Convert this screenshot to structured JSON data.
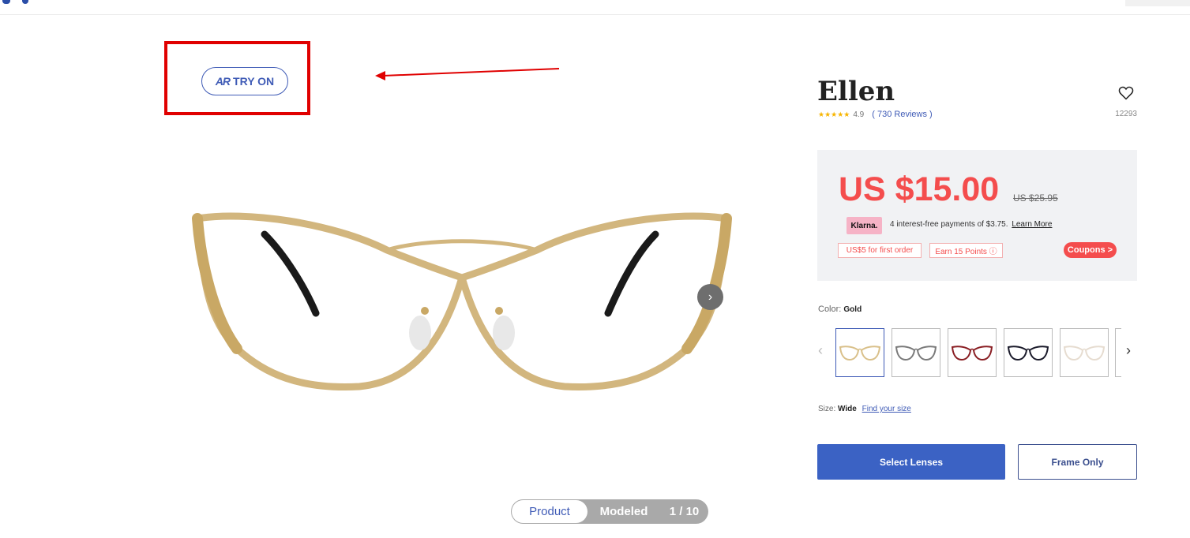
{
  "gallery": {
    "tryon_ar": "AR",
    "tryon_label": "TRY ON",
    "next_glyph": "›",
    "view_toggle": {
      "product": "Product",
      "modeled": "Modeled",
      "count": "1 / 10"
    }
  },
  "product": {
    "title": "Ellen",
    "stars": "★★★★★",
    "rating": "4.9",
    "reviews": "( 730 Reviews )",
    "sku": "12293",
    "price": "US $15.00",
    "old_price": "US $25.95",
    "klarna_badge": "Klarna.",
    "klarna_text": "4 interest-free payments of $3.75.",
    "klarna_link": "Learn More",
    "chip_first_order": "US$5 for first order",
    "chip_points": "Earn 15 Points ⓘ",
    "coupons_label": "Coupons >",
    "color_label": "Color:",
    "color_value": "Gold",
    "size_label": "Size:",
    "size_value": "Wide",
    "find_size": "Find your size",
    "select_lenses": "Select Lenses",
    "frame_only": "Frame Only",
    "swatch_prev_glyph": "‹",
    "swatch_next_glyph": "›"
  },
  "swatches": [
    {
      "name": "Gold",
      "frame": "#d9c08a",
      "active": true
    },
    {
      "name": "Silver",
      "frame": "#7a7a7a",
      "active": false
    },
    {
      "name": "Red",
      "frame": "#8a1f24",
      "active": false
    },
    {
      "name": "Black",
      "frame": "#1b1b2b",
      "active": false
    },
    {
      "name": "Clear",
      "frame": "#e6dcd0",
      "active": false
    }
  ],
  "colors": {
    "accent": "#3b62c4",
    "price_red": "#f44d4d",
    "highlight_red": "#e00000"
  }
}
